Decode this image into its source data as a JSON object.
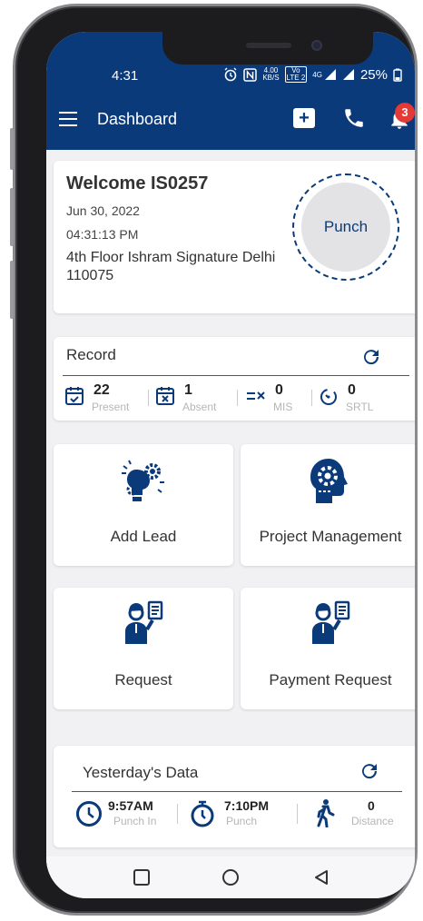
{
  "status": {
    "time": "4:31",
    "speed_value": "4.00",
    "speed_unit": "KB/S",
    "volte_top": "Vo",
    "volte_bottom": "LTE 2",
    "network": "4G",
    "battery": "25%"
  },
  "appbar": {
    "title": "Dashboard",
    "notification_count": "3"
  },
  "welcome": {
    "title": "Welcome IS0257",
    "date": "Jun 30, 2022",
    "time": "04:31:13 PM",
    "address": "4th Floor Ishram Signature Delhi 110075",
    "punch_label": "Punch"
  },
  "record": {
    "title": "Record",
    "stats": [
      {
        "value": "22",
        "label": "Present"
      },
      {
        "value": "1",
        "label": "Absent"
      },
      {
        "value": "0",
        "label": "MIS"
      },
      {
        "value": "0",
        "label": "SRTL"
      }
    ]
  },
  "tiles": [
    {
      "label": "Add Lead",
      "icon": "brain-gear-icon"
    },
    {
      "label": "Project Management",
      "icon": "head-gear-icon"
    },
    {
      "label": "Request",
      "icon": "person-checklist-icon"
    },
    {
      "label": "Payment Request",
      "icon": "person-checklist-icon"
    }
  ],
  "yesterday": {
    "title": "Yesterday's Data",
    "stats": [
      {
        "value": "9:57AM",
        "label": "Punch In"
      },
      {
        "value": "7:10PM",
        "label": "Punch"
      },
      {
        "value": "0",
        "label": "Distance"
      }
    ]
  },
  "colors": {
    "primary": "#0a3a7a",
    "badge": "#e53935",
    "background": "#f1f1f3"
  }
}
